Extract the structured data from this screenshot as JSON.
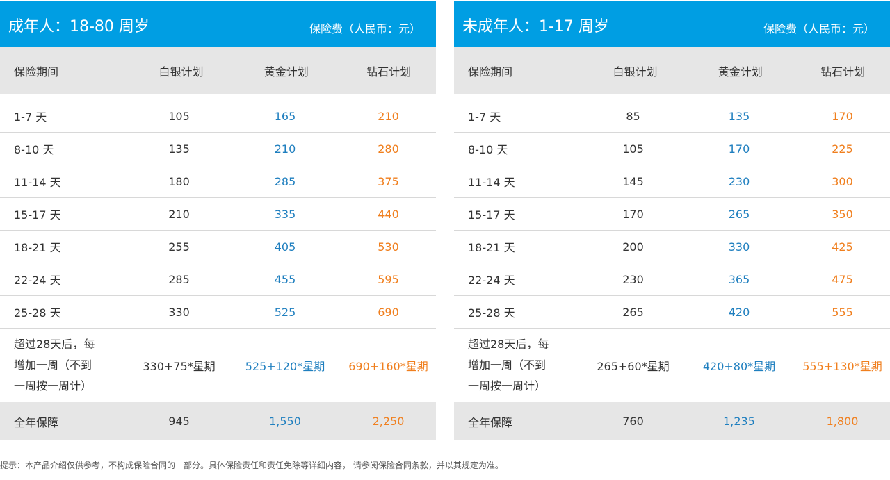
{
  "left": {
    "title": "成年人：18-80 周岁",
    "unit": "保险费（人民币：元）",
    "headers": [
      "保险期间",
      "白银计划",
      "黄金计划",
      "钻石计划"
    ],
    "rows": [
      {
        "period": "1-7 天",
        "silver": "105",
        "gold": "165",
        "diamond": "210"
      },
      {
        "period": "8-10 天",
        "silver": "135",
        "gold": "210",
        "diamond": "280"
      },
      {
        "period": "11-14 天",
        "silver": "180",
        "gold": "285",
        "diamond": "375"
      },
      {
        "period": "15-17 天",
        "silver": "210",
        "gold": "335",
        "diamond": "440"
      },
      {
        "period": "18-21 天",
        "silver": "255",
        "gold": "405",
        "diamond": "530"
      },
      {
        "period": "22-24 天",
        "silver": "285",
        "gold": "455",
        "diamond": "595"
      },
      {
        "period": "25-28 天",
        "silver": "330",
        "gold": "525",
        "diamond": "690"
      }
    ],
    "extra": {
      "line1": "超过28天后，每",
      "line2": "增加一周（不到",
      "line3": "一周按一周计）",
      "silver": "330+75*星期",
      "gold": "525+120*星期",
      "diamond": "690+160*星期"
    },
    "total": {
      "label": "全年保障",
      "silver": "945",
      "gold": "1,550",
      "diamond": "2,250"
    }
  },
  "right": {
    "title": "未成年人：1-17 周岁",
    "unit": "保险费（人民币：元）",
    "headers": [
      "保险期间",
      "白银计划",
      "黄金计划",
      "钻石计划"
    ],
    "rows": [
      {
        "period": "1-7 天",
        "silver": "85",
        "gold": "135",
        "diamond": "170"
      },
      {
        "period": "8-10 天",
        "silver": "105",
        "gold": "170",
        "diamond": "225"
      },
      {
        "period": "11-14 天",
        "silver": "145",
        "gold": "230",
        "diamond": "300"
      },
      {
        "period": "15-17 天",
        "silver": "170",
        "gold": "265",
        "diamond": "350"
      },
      {
        "period": "18-21 天",
        "silver": "200",
        "gold": "330",
        "diamond": "425"
      },
      {
        "period": "22-24 天",
        "silver": "230",
        "gold": "365",
        "diamond": "475"
      },
      {
        "period": "25-28 天",
        "silver": "265",
        "gold": "420",
        "diamond": "555"
      }
    ],
    "extra": {
      "line1": "超过28天后，每",
      "line2": "增加一周（不到",
      "line3": "一周按一周计）",
      "silver": "265+60*星期",
      "gold": "420+80*星期",
      "diamond": "555+130*星期"
    },
    "total": {
      "label": "全年保障",
      "silver": "760",
      "gold": "1,235",
      "diamond": "1,800"
    }
  },
  "note": "提示：本产品介绍仅供参考，不构成保险合同的一部分。具体保险责任和责任免除等详细内容，  请参阅保险合同条款，并以其规定为准。"
}
